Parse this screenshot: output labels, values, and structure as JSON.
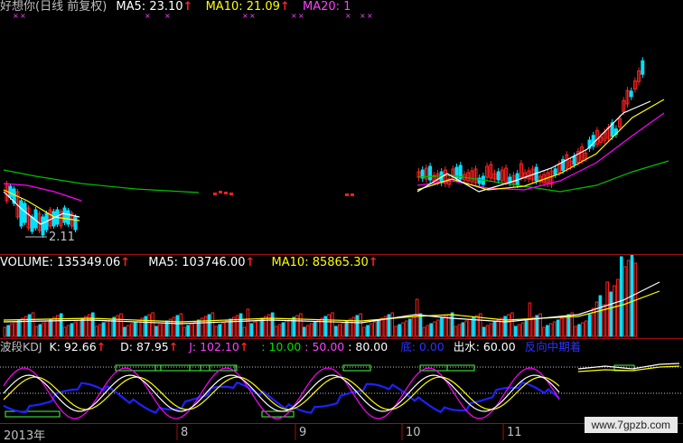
{
  "price_panel": {
    "title": "好想你(日线 前复权)",
    "ma5_label": "MA5: 23.10",
    "ma10_label": "MA10: 21.09",
    "ma20_label": "MA20: 1",
    "low_marker": "2.11",
    "arrow": "↑"
  },
  "volume_panel": {
    "volume_label": "VOLUME: 135349.06",
    "ma5_label": "MA5: 103746.00",
    "ma10_label": "MA10: 85865.30",
    "arrow": "↑"
  },
  "kdj_panel": {
    "name": "波段KDJ",
    "k_label": "K: 92.66",
    "d_label": "D: 87.95",
    "j_label": "J: 102.10",
    "level1": ": 10.00",
    "level2": ": 50.00",
    "level3": ": 80.00",
    "bottom_label": "底: 0.00",
    "exit_label": "出水: 60.00",
    "reversal_label": "反向中期着",
    "arrow": "↑"
  },
  "x_axis": {
    "labels": [
      "2013年",
      "8",
      "9",
      "10",
      "11"
    ]
  },
  "watermark": "www.7gpzb.com",
  "colors": {
    "up": "#ff2020",
    "down": "#00e0ff",
    "ma5": "#ffffff",
    "ma10": "#ffff00",
    "ma20": "#ff00ff",
    "ma_long": "#00c000",
    "axis": "#a01010",
    "blue_line": "#2020ff"
  }
}
